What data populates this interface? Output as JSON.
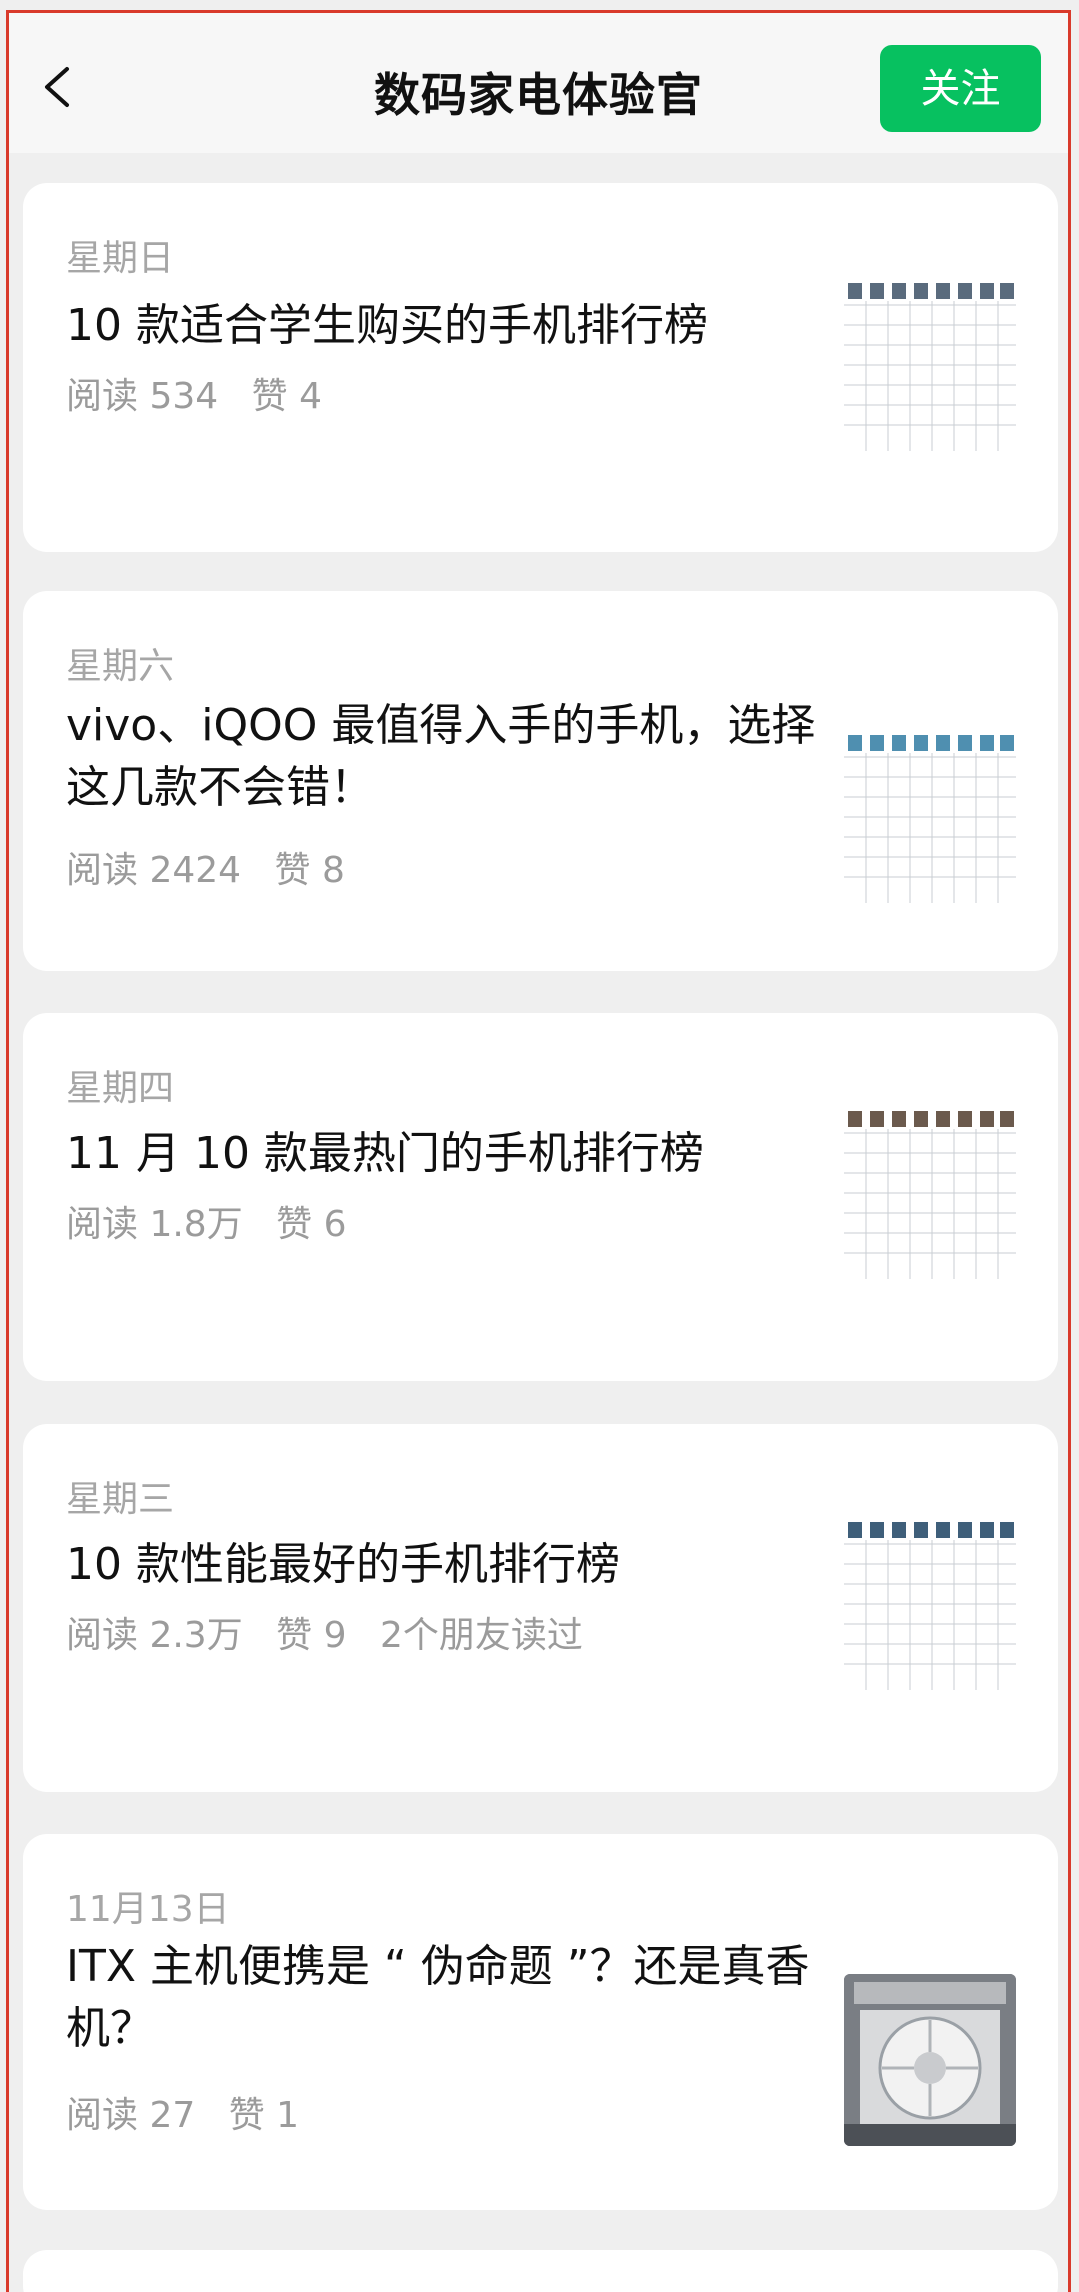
{
  "header": {
    "title": "数码家电体验官",
    "follow_label": "关注"
  },
  "articles": [
    {
      "date": "星期日",
      "title": "10 款适合学生购买的手机排行榜",
      "reads": "阅读 534",
      "likes": "赞 4",
      "friends": "",
      "thumb": "phone-table-thumbnail"
    },
    {
      "date": "星期六",
      "title": "vivo、iQOO 最值得入手的手机，选择这几款不会错！",
      "reads": "阅读 2424",
      "likes": "赞 8",
      "friends": "",
      "thumb": "phone-table-thumbnail"
    },
    {
      "date": "星期四",
      "title": "11 月 10 款最热门的手机排行榜",
      "reads": "阅读 1.8万",
      "likes": "赞 6",
      "friends": "",
      "thumb": "phone-table-thumbnail"
    },
    {
      "date": "星期三",
      "title": "10 款性能最好的手机排行榜",
      "reads": "阅读 2.3万",
      "likes": "赞 9",
      "friends": "2个朋友读过",
      "thumb": "phone-table-thumbnail"
    },
    {
      "date": "11月13日",
      "title": "ITX 主机便携是 “ 伪命题 ”？还是真香机？",
      "reads": "阅读 27",
      "likes": "赞 1",
      "friends": "",
      "thumb": "pc-cooler-photo"
    }
  ],
  "colors": {
    "accent": "#07c160",
    "frame_border": "#d93a2b",
    "background": "#efefef"
  }
}
